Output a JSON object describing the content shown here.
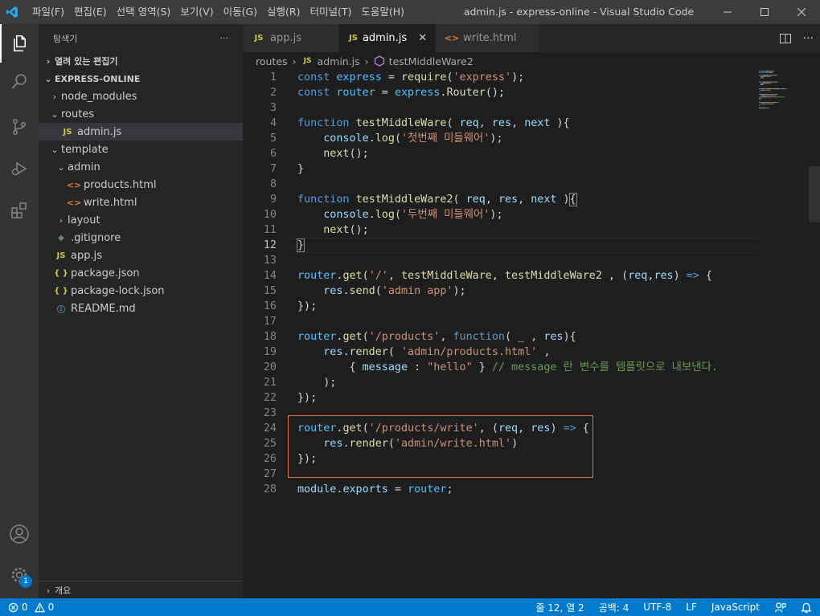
{
  "titlebar": {
    "menu": [
      "파일(F)",
      "편집(E)",
      "선택 영역(S)",
      "보기(V)",
      "이동(G)",
      "실행(R)",
      "터미널(T)",
      "도움말(H)"
    ],
    "title": "admin.js - express-online - Visual Studio Code"
  },
  "activity": {
    "badge": "1"
  },
  "sidebar": {
    "header": "탐색기",
    "more": "···",
    "open_editors": "열려 있는 편집기",
    "project": "EXPRESS-ONLINE",
    "tree": [
      {
        "label": "node_modules",
        "icon": "chevron-right"
      },
      {
        "label": "routes",
        "icon": "chevron-down"
      },
      {
        "label": "admin.js",
        "icon": "js",
        "selected": true
      },
      {
        "label": "template",
        "icon": "chevron-down"
      },
      {
        "label": "admin",
        "icon": "chevron-down"
      },
      {
        "label": "products.html",
        "icon": "html"
      },
      {
        "label": "write.html",
        "icon": "html"
      },
      {
        "label": "layout",
        "icon": "chevron-right"
      },
      {
        "label": ".gitignore",
        "icon": "git"
      },
      {
        "label": "app.js",
        "icon": "js"
      },
      {
        "label": "package.json",
        "icon": "json"
      },
      {
        "label": "package-lock.json",
        "icon": "json"
      },
      {
        "label": "README.md",
        "icon": "info"
      }
    ],
    "outline": "개요",
    "js_glyph": "JS",
    "json_glyph": "{ }",
    "html_glyph": "<>",
    "git_glyph": "◆",
    "info_glyph": "ⓘ"
  },
  "tabs": [
    {
      "label": "app.js",
      "icon": "js",
      "active": false
    },
    {
      "label": "admin.js",
      "icon": "js",
      "active": true
    },
    {
      "label": "write.html",
      "icon": "html",
      "active": false
    }
  ],
  "breadcrumbs": {
    "folder": "routes",
    "file": "admin.js",
    "symbol": "testMiddleWare2",
    "sep": "›"
  },
  "code": {
    "current_line": 12,
    "lines": [
      [
        [
          "kw",
          "const"
        ],
        [
          "pl",
          " "
        ],
        [
          "var",
          "express"
        ],
        [
          "pl",
          " = "
        ],
        [
          "fn",
          "require"
        ],
        [
          "pl",
          "("
        ],
        [
          "str",
          "'express'"
        ],
        [
          "pl",
          ");"
        ]
      ],
      [
        [
          "kw",
          "const"
        ],
        [
          "pl",
          " "
        ],
        [
          "var",
          "router"
        ],
        [
          "pl",
          " = "
        ],
        [
          "var",
          "express"
        ],
        [
          "pl",
          "."
        ],
        [
          "fn",
          "Router"
        ],
        [
          "pl",
          "();"
        ]
      ],
      [],
      [
        [
          "kw",
          "function"
        ],
        [
          "pl",
          " "
        ],
        [
          "fn",
          "testMiddleWare"
        ],
        [
          "pl",
          "( "
        ],
        [
          "par",
          "req"
        ],
        [
          "pl",
          ", "
        ],
        [
          "par",
          "res"
        ],
        [
          "pl",
          ", "
        ],
        [
          "par",
          "next"
        ],
        [
          "pl",
          " ){"
        ]
      ],
      [
        [
          "pl",
          "    "
        ],
        [
          "par",
          "console"
        ],
        [
          "pl",
          "."
        ],
        [
          "fn",
          "log"
        ],
        [
          "pl",
          "("
        ],
        [
          "str",
          "'첫번째 미들웨어'"
        ],
        [
          "pl",
          ");"
        ]
      ],
      [
        [
          "pl",
          "    "
        ],
        [
          "fn",
          "next"
        ],
        [
          "pl",
          "();"
        ]
      ],
      [
        [
          "pl",
          "}"
        ]
      ],
      [],
      [
        [
          "kw",
          "function"
        ],
        [
          "pl",
          " "
        ],
        [
          "fn",
          "testMiddleWare2"
        ],
        [
          "pl",
          "( "
        ],
        [
          "par",
          "req"
        ],
        [
          "pl",
          ", "
        ],
        [
          "par",
          "res"
        ],
        [
          "pl",
          ", "
        ],
        [
          "par",
          "next"
        ],
        [
          "pl",
          " )"
        ],
        [
          "br",
          "{"
        ]
      ],
      [
        [
          "pl",
          "    "
        ],
        [
          "par",
          "console"
        ],
        [
          "pl",
          "."
        ],
        [
          "fn",
          "log"
        ],
        [
          "pl",
          "("
        ],
        [
          "str",
          "'두번째 미들웨어'"
        ],
        [
          "pl",
          ");"
        ]
      ],
      [
        [
          "pl",
          "    "
        ],
        [
          "fn",
          "next"
        ],
        [
          "pl",
          "();"
        ]
      ],
      [
        [
          "br",
          "}"
        ]
      ],
      [],
      [
        [
          "var",
          "router"
        ],
        [
          "pl",
          "."
        ],
        [
          "fn",
          "get"
        ],
        [
          "pl",
          "("
        ],
        [
          "str",
          "'/'"
        ],
        [
          "pl",
          ", "
        ],
        [
          "fn",
          "testMiddleWare"
        ],
        [
          "pl",
          ", "
        ],
        [
          "fn",
          "testMiddleWare2"
        ],
        [
          "pl",
          " , ("
        ],
        [
          "par",
          "req"
        ],
        [
          "pl",
          ","
        ],
        [
          "par",
          "res"
        ],
        [
          "pl",
          ") "
        ],
        [
          "kw",
          "=>"
        ],
        [
          "pl",
          " {"
        ]
      ],
      [
        [
          "pl",
          "    "
        ],
        [
          "par",
          "res"
        ],
        [
          "pl",
          "."
        ],
        [
          "fn",
          "send"
        ],
        [
          "pl",
          "("
        ],
        [
          "str",
          "'admin app'"
        ],
        [
          "pl",
          ");"
        ]
      ],
      [
        [
          "pl",
          "});"
        ]
      ],
      [],
      [
        [
          "var",
          "router"
        ],
        [
          "pl",
          "."
        ],
        [
          "fn",
          "get"
        ],
        [
          "pl",
          "("
        ],
        [
          "str",
          "'/products'"
        ],
        [
          "pl",
          ", "
        ],
        [
          "kw",
          "function"
        ],
        [
          "pl",
          "( "
        ],
        [
          "par",
          "_"
        ],
        [
          "pl",
          " , "
        ],
        [
          "par",
          "res"
        ],
        [
          "pl",
          "){"
        ]
      ],
      [
        [
          "pl",
          "    "
        ],
        [
          "par",
          "res"
        ],
        [
          "pl",
          "."
        ],
        [
          "fn",
          "render"
        ],
        [
          "pl",
          "( "
        ],
        [
          "str",
          "'admin/products.html'"
        ],
        [
          "pl",
          " ,"
        ]
      ],
      [
        [
          "pl",
          "        { "
        ],
        [
          "par",
          "message"
        ],
        [
          "pl",
          " : "
        ],
        [
          "str",
          "\"hello\""
        ],
        [
          "pl",
          " } "
        ],
        [
          "cm",
          "// message 란 변수를 템플릿으로 내보낸다."
        ]
      ],
      [
        [
          "pl",
          "    );"
        ]
      ],
      [
        [
          "pl",
          "});"
        ]
      ],
      [],
      [
        [
          "var",
          "router"
        ],
        [
          "pl",
          "."
        ],
        [
          "fn",
          "get"
        ],
        [
          "pl",
          "("
        ],
        [
          "str",
          "'/products/write'"
        ],
        [
          "pl",
          ", ("
        ],
        [
          "par",
          "req"
        ],
        [
          "pl",
          ", "
        ],
        [
          "par",
          "res"
        ],
        [
          "pl",
          ") "
        ],
        [
          "kw",
          "=>"
        ],
        [
          "pl",
          " {"
        ]
      ],
      [
        [
          "pl",
          "    "
        ],
        [
          "par",
          "res"
        ],
        [
          "pl",
          "."
        ],
        [
          "fn",
          "render"
        ],
        [
          "pl",
          "("
        ],
        [
          "str",
          "'admin/write.html'"
        ],
        [
          "pl",
          ")"
        ]
      ],
      [
        [
          "pl",
          "});"
        ]
      ],
      [],
      [
        [
          "par",
          "module"
        ],
        [
          "pl",
          "."
        ],
        [
          "par",
          "exports"
        ],
        [
          "pl",
          " = "
        ],
        [
          "var",
          "router"
        ],
        [
          "pl",
          ";"
        ]
      ]
    ]
  },
  "statusbar": {
    "errors": "0",
    "warnings": "0",
    "position": "줄 12, 열 2",
    "spaces": "공백: 4",
    "encoding": "UTF-8",
    "eol": "LF",
    "language": "JavaScript"
  },
  "colors": {
    "accent": "#007acc",
    "highlight_box": "#e0704a"
  }
}
